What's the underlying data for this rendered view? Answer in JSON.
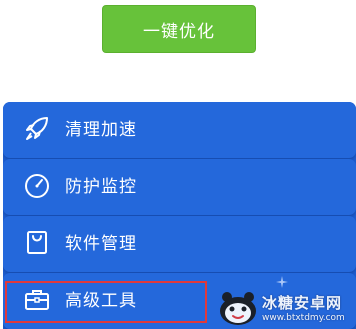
{
  "header": {
    "optimize_label": "一键优化"
  },
  "menu": {
    "items": [
      {
        "label": "清理加速",
        "icon": "rocket-icon"
      },
      {
        "label": "防护监控",
        "icon": "gauge-icon"
      },
      {
        "label": "软件管理",
        "icon": "shopping-bag-icon"
      },
      {
        "label": "高级工具",
        "icon": "toolbox-icon"
      }
    ]
  },
  "watermark": {
    "title": "冰糖安卓网",
    "url": "www.btxtdmy.com"
  },
  "colors": {
    "button_green": "#67c23a",
    "menu_blue": "#2468db",
    "highlight_red": "#e0393b"
  }
}
